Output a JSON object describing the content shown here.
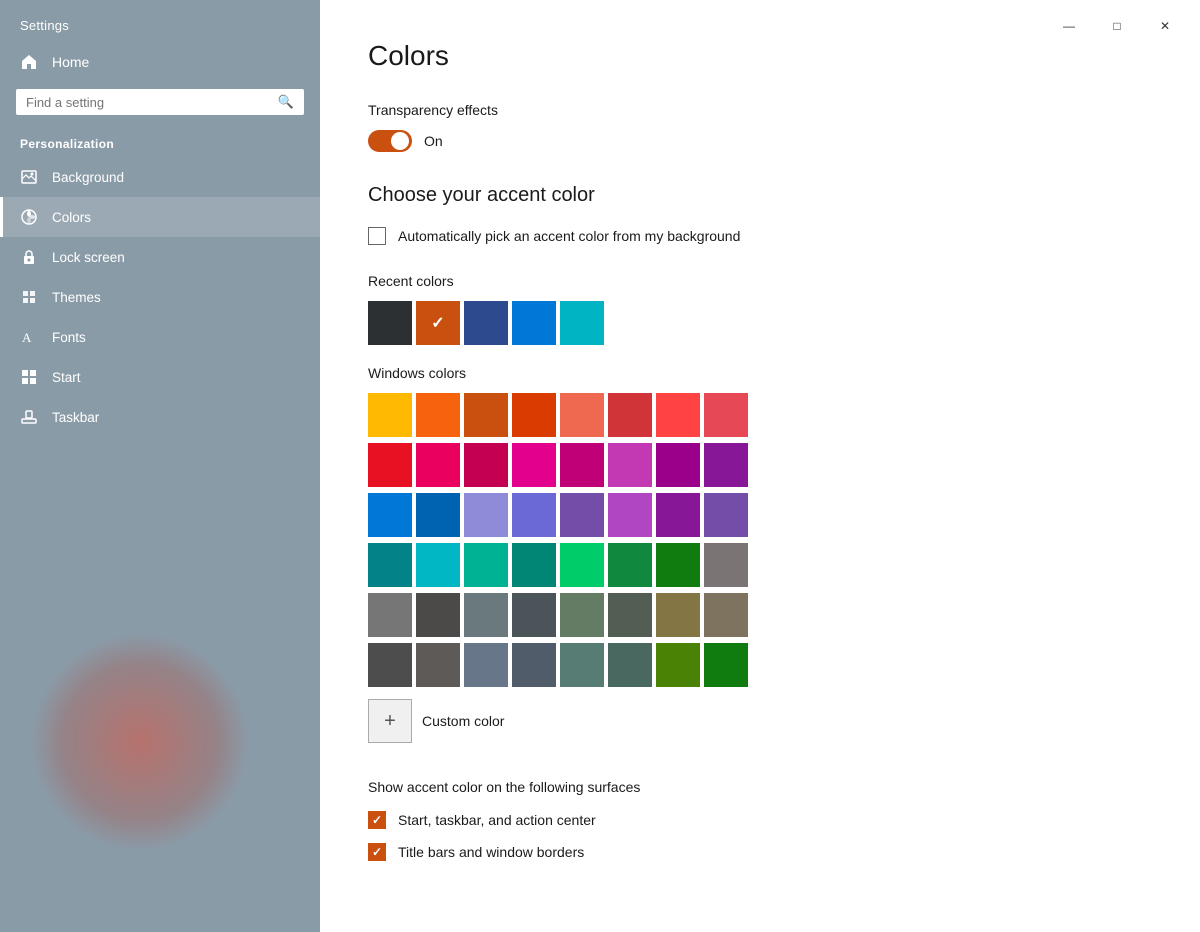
{
  "app": {
    "title": "Settings"
  },
  "sidebar": {
    "title": "Settings",
    "home_label": "Home",
    "search_placeholder": "Find a setting",
    "section_title": "Personalization",
    "items": [
      {
        "id": "background",
        "label": "Background",
        "icon": "background"
      },
      {
        "id": "colors",
        "label": "Colors",
        "icon": "colors",
        "active": true
      },
      {
        "id": "lock-screen",
        "label": "Lock screen",
        "icon": "lock"
      },
      {
        "id": "themes",
        "label": "Themes",
        "icon": "themes"
      },
      {
        "id": "fonts",
        "label": "Fonts",
        "icon": "fonts"
      },
      {
        "id": "start",
        "label": "Start",
        "icon": "start"
      },
      {
        "id": "taskbar",
        "label": "Taskbar",
        "icon": "taskbar"
      }
    ]
  },
  "main": {
    "page_title": "Colors",
    "transparency": {
      "label": "Transparency effects",
      "state": "On",
      "enabled": true
    },
    "accent": {
      "title": "Choose your accent color",
      "auto_label": "Automatically pick an accent color from my background",
      "recent_label": "Recent colors",
      "windows_label": "Windows colors",
      "custom_label": "Custom color"
    },
    "surfaces": {
      "title": "Show accent color on the following surfaces",
      "items": [
        {
          "label": "Start, taskbar, and action center",
          "checked": true
        },
        {
          "label": "Title bars and window borders",
          "checked": true
        }
      ]
    },
    "recent_colors": [
      "#2d3032",
      "#ca5010",
      "#2e4a8e",
      "#0078d7",
      "#00b4c4"
    ],
    "recent_selected": 1,
    "windows_colors": [
      [
        "#ffb900",
        "#f7630c",
        "#ca5010",
        "#da3b01",
        "#ef6950",
        "#d13438",
        "#ff4343",
        "#e74856"
      ],
      [
        "#e81123",
        "#ea005e",
        "#c30052",
        "#e3008c",
        "#bf0077",
        "#c239b3",
        "#9a0089",
        "#881798"
      ],
      [
        "#0078d7",
        "#0063b1",
        "#8e8cd8",
        "#6b69d6",
        "#744da9",
        "#b146c2",
        "#881798",
        "#744da9"
      ],
      [
        "#038387",
        "#00b7c3",
        "#00b294",
        "#018574",
        "#00cc6a",
        "#10893e",
        "#107c10",
        "#7a7574"
      ],
      [
        "#767676",
        "#4c4a48",
        "#69797e",
        "#4a5459",
        "#647c64",
        "#525e54",
        "#847545",
        "#7e735f"
      ],
      [
        "#4d4d4d",
        "#5d5a58",
        "#68768a",
        "#515c6b",
        "#567c73",
        "#486860",
        "#498205",
        "#107c10"
      ]
    ]
  },
  "window_controls": {
    "minimize": "—",
    "maximize": "□",
    "close": "✕"
  }
}
